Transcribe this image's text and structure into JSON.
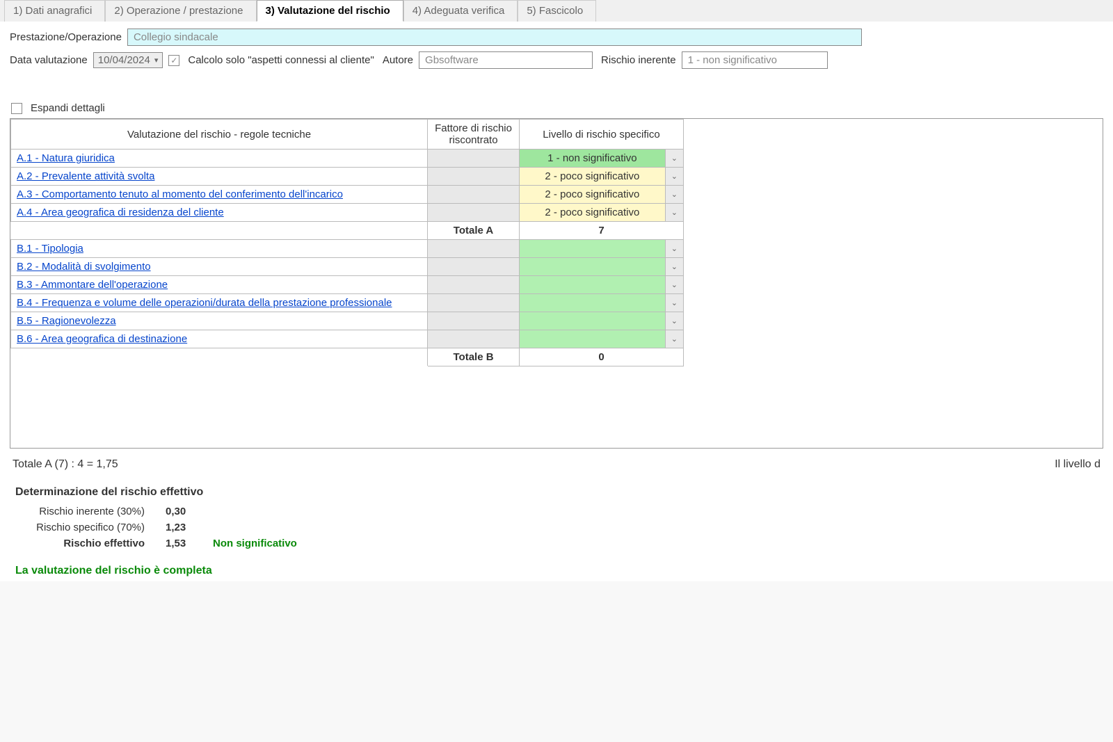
{
  "tabs": [
    {
      "label": "1) Dati anagrafici",
      "active": false
    },
    {
      "label": "2) Operazione / prestazione",
      "active": false
    },
    {
      "label": "3) Valutazione del rischio",
      "active": true
    },
    {
      "label": "4) Adeguata verifica",
      "active": false
    },
    {
      "label": "5) Fascicolo",
      "active": false
    }
  ],
  "form": {
    "prestazione_label": "Prestazione/Operazione",
    "prestazione_value": "Collegio sindacale",
    "data_label": "Data valutazione",
    "data_value": "10/04/2024",
    "calc_checkbox_checked": true,
    "calc_label": "Calcolo solo \"aspetti connessi al cliente\"",
    "autore_label": "Autore",
    "autore_value": "Gbsoftware",
    "rischio_inerente_label": "Rischio inerente",
    "rischio_inerente_value": "1 - non significativo"
  },
  "expand_label": "Espandi dettagli",
  "table": {
    "header_rule": "Valutazione del rischio  -  regole tecniche",
    "header_factor": "Fattore di rischio riscontrato",
    "header_level": "Livello di rischio specifico",
    "rowsA": [
      {
        "link": "A.1 - Natura giuridica",
        "level": "1 - non significativo",
        "style": "green"
      },
      {
        "link": "A.2 - Prevalente attività svolta",
        "level": "2 - poco significativo",
        "style": "yellow"
      },
      {
        "link": "A.3 - Comportamento tenuto al momento del conferimento dell'incarico",
        "level": "2 - poco significativo",
        "style": "yellow"
      },
      {
        "link": "A.4 - Area geografica di residenza del cliente",
        "level": "2 - poco significativo",
        "style": "yellow"
      }
    ],
    "totalA_label": "Totale A",
    "totalA_value": "7",
    "rowsB": [
      {
        "link": "B.1 - Tipologia"
      },
      {
        "link": "B.2 - Modalità di svolgimento"
      },
      {
        "link": "B.3 - Ammontare dell'operazione"
      },
      {
        "link": "B.4 - Frequenza e volume delle operazioni/durata della prestazione professionale"
      },
      {
        "link": "B.5 - Ragionevolezza"
      },
      {
        "link": "B.6 - Area geografica di destinazione"
      }
    ],
    "totalB_label": "Totale B",
    "totalB_value": "0"
  },
  "summary": {
    "totalA_line": "Totale A (7) : 4 = 1,75",
    "right_fragment": "Il livello d",
    "det_title": "Determinazione del rischio effettivo",
    "lines": [
      {
        "label": "Rischio inerente (30%)",
        "value": "0,30",
        "bold": false
      },
      {
        "label": "Rischio specifico (70%)",
        "value": "1,23",
        "bold": false
      },
      {
        "label": "Rischio effettivo",
        "value": "1,53",
        "bold": true,
        "desc": "Non significativo"
      }
    ],
    "complete": "La valutazione del rischio è completa"
  }
}
